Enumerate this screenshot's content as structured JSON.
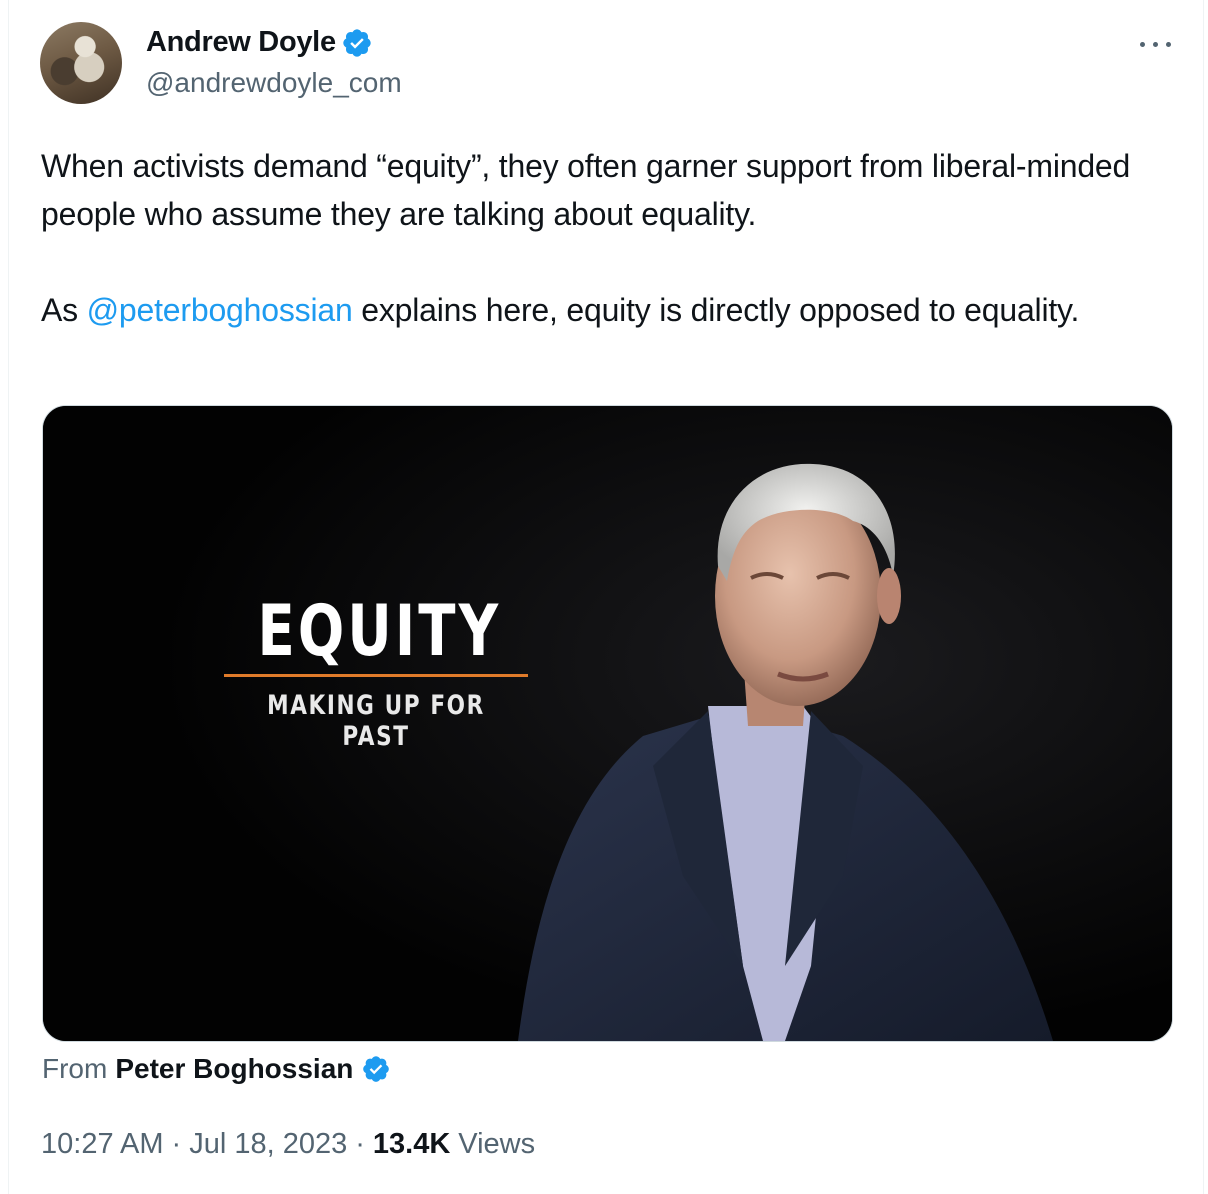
{
  "author": {
    "name": "Andrew Doyle",
    "handle": "@andrewdoyle_com",
    "verified_icon": "verified-badge-icon"
  },
  "tweet": {
    "paragraph1": "When activists demand “equity”, they often garner support from liberal-minded people who assume they are talking about equality.",
    "paragraph2_prefix": "As ",
    "mention": "@peterboghossian",
    "paragraph2_suffix": " explains here, equity is directly opposed to equality."
  },
  "media": {
    "overlay_title": "EQUITY",
    "overlay_subtitle": "MAKING UP FOR PAST"
  },
  "attribution": {
    "from_label": "From",
    "from_name": "Peter Boghossian"
  },
  "meta": {
    "time": "10:27 AM",
    "separator": "·",
    "date": "Jul 18, 2023",
    "views_count": "13.4K",
    "views_label": "Views"
  },
  "colors": {
    "accent": "#1d9bf0",
    "secondary_text": "#536471",
    "overlay_rule": "#e07b2a"
  }
}
